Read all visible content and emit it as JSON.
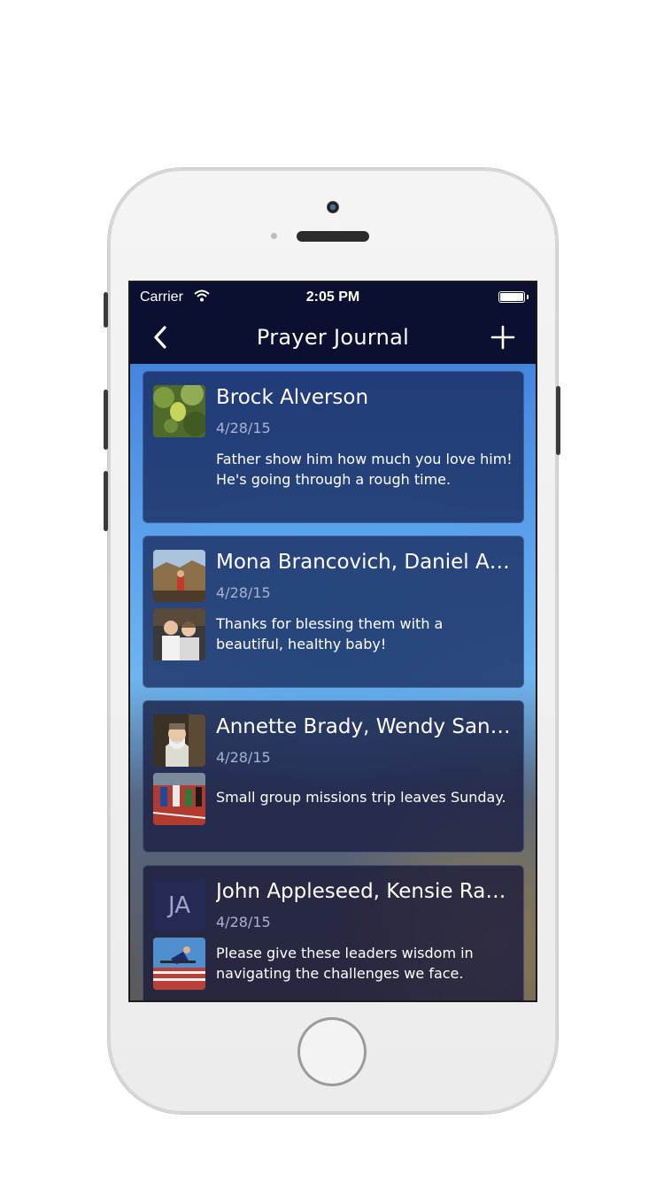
{
  "status_bar": {
    "carrier": "Carrier",
    "time": "2:05 PM"
  },
  "nav": {
    "title": "Prayer Journal",
    "back_icon": "chevron-left-icon",
    "add_icon": "plus-icon"
  },
  "entries": [
    {
      "name": "Brock Alverson",
      "date": "4/28/15",
      "text": "Father show him how much you love him! He's going through a rough time."
    },
    {
      "name": "Mona Brancovich, Daniel Al…",
      "date": "4/28/15",
      "text": "Thanks for blessing them with a beautiful, healthy baby!"
    },
    {
      "name": "Annette Brady, Wendy Sant…",
      "date": "4/28/15",
      "text": "Small group missions trip leaves Sunday."
    },
    {
      "name": "John Appleseed, Kensie Ran…",
      "date": "4/28/15",
      "initials": "JA",
      "text": "Please give these leaders wisdom in navigating the challenges we face."
    }
  ]
}
